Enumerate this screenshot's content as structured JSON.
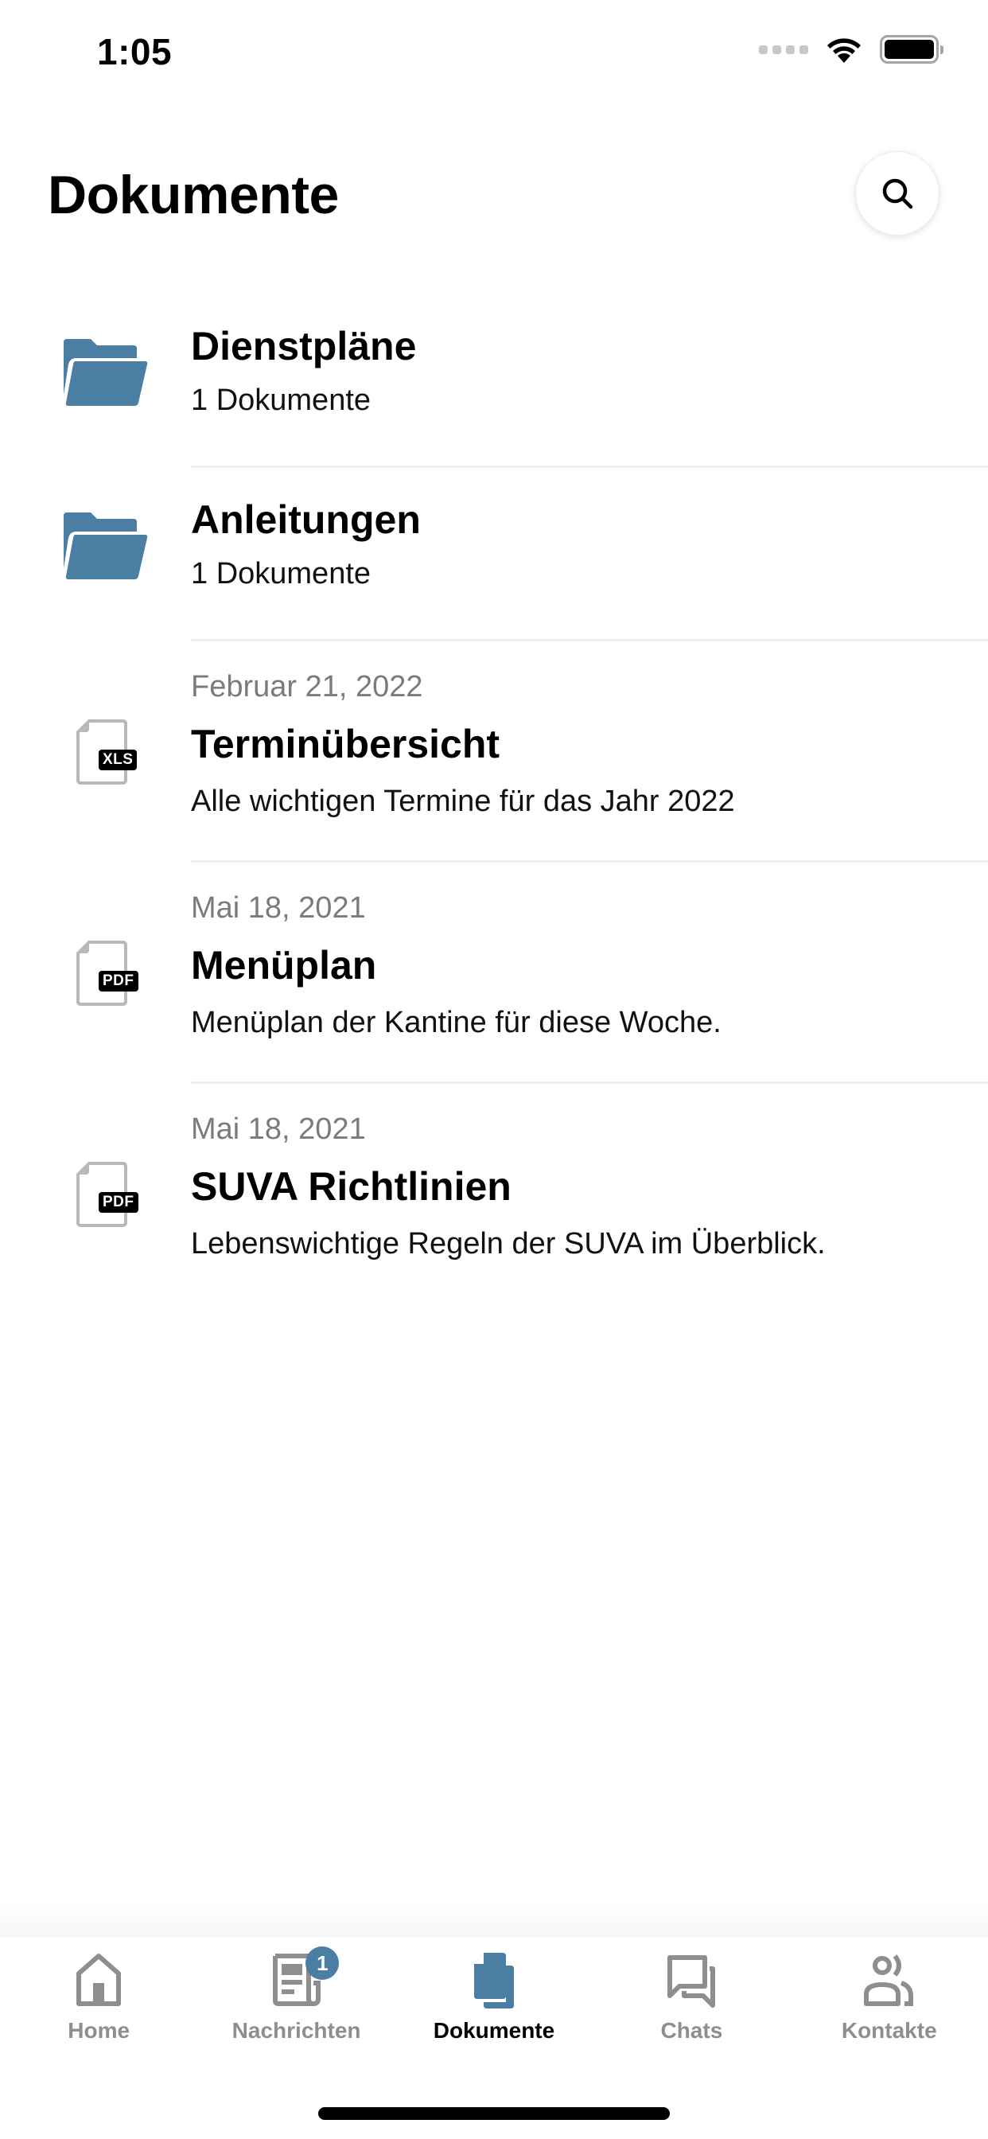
{
  "status_bar": {
    "time": "1:05"
  },
  "header": {
    "title": "Dokumente",
    "search_icon": "search-icon"
  },
  "colors": {
    "accent": "#4a7ea3",
    "inactive": "#8e8e8e",
    "date_text": "#7b7b7b",
    "divider": "#efefef"
  },
  "folders": [
    {
      "title": "Dienstpläne",
      "subtitle": "1 Dokumente",
      "icon": "folder-icon"
    },
    {
      "title": "Anleitungen",
      "subtitle": "1 Dokumente",
      "icon": "folder-icon"
    }
  ],
  "files": [
    {
      "date": "Februar 21, 2022",
      "title": "Terminübersicht",
      "subtitle": "Alle wichtigen Termine für das Jahr 2022",
      "type": "XLS",
      "icon": "xls-file-icon"
    },
    {
      "date": "Mai 18, 2021",
      "title": "Menüplan",
      "subtitle": "Menüplan der Kantine für diese Woche.",
      "type": "PDF",
      "icon": "pdf-file-icon"
    },
    {
      "date": "Mai 18, 2021",
      "title": "SUVA Richtlinien",
      "subtitle": "Lebenswichtige Regeln der SUVA im Überblick.",
      "type": "PDF",
      "icon": "pdf-file-icon"
    }
  ],
  "tabbar": {
    "tabs": [
      {
        "label": "Home",
        "icon": "home-icon",
        "active": false
      },
      {
        "label": "Nachrichten",
        "icon": "news-icon",
        "active": false,
        "badge": "1"
      },
      {
        "label": "Dokumente",
        "icon": "documents-icon",
        "active": true
      },
      {
        "label": "Chats",
        "icon": "chat-icon",
        "active": false
      },
      {
        "label": "Kontakte",
        "icon": "contacts-icon",
        "active": false
      }
    ]
  }
}
